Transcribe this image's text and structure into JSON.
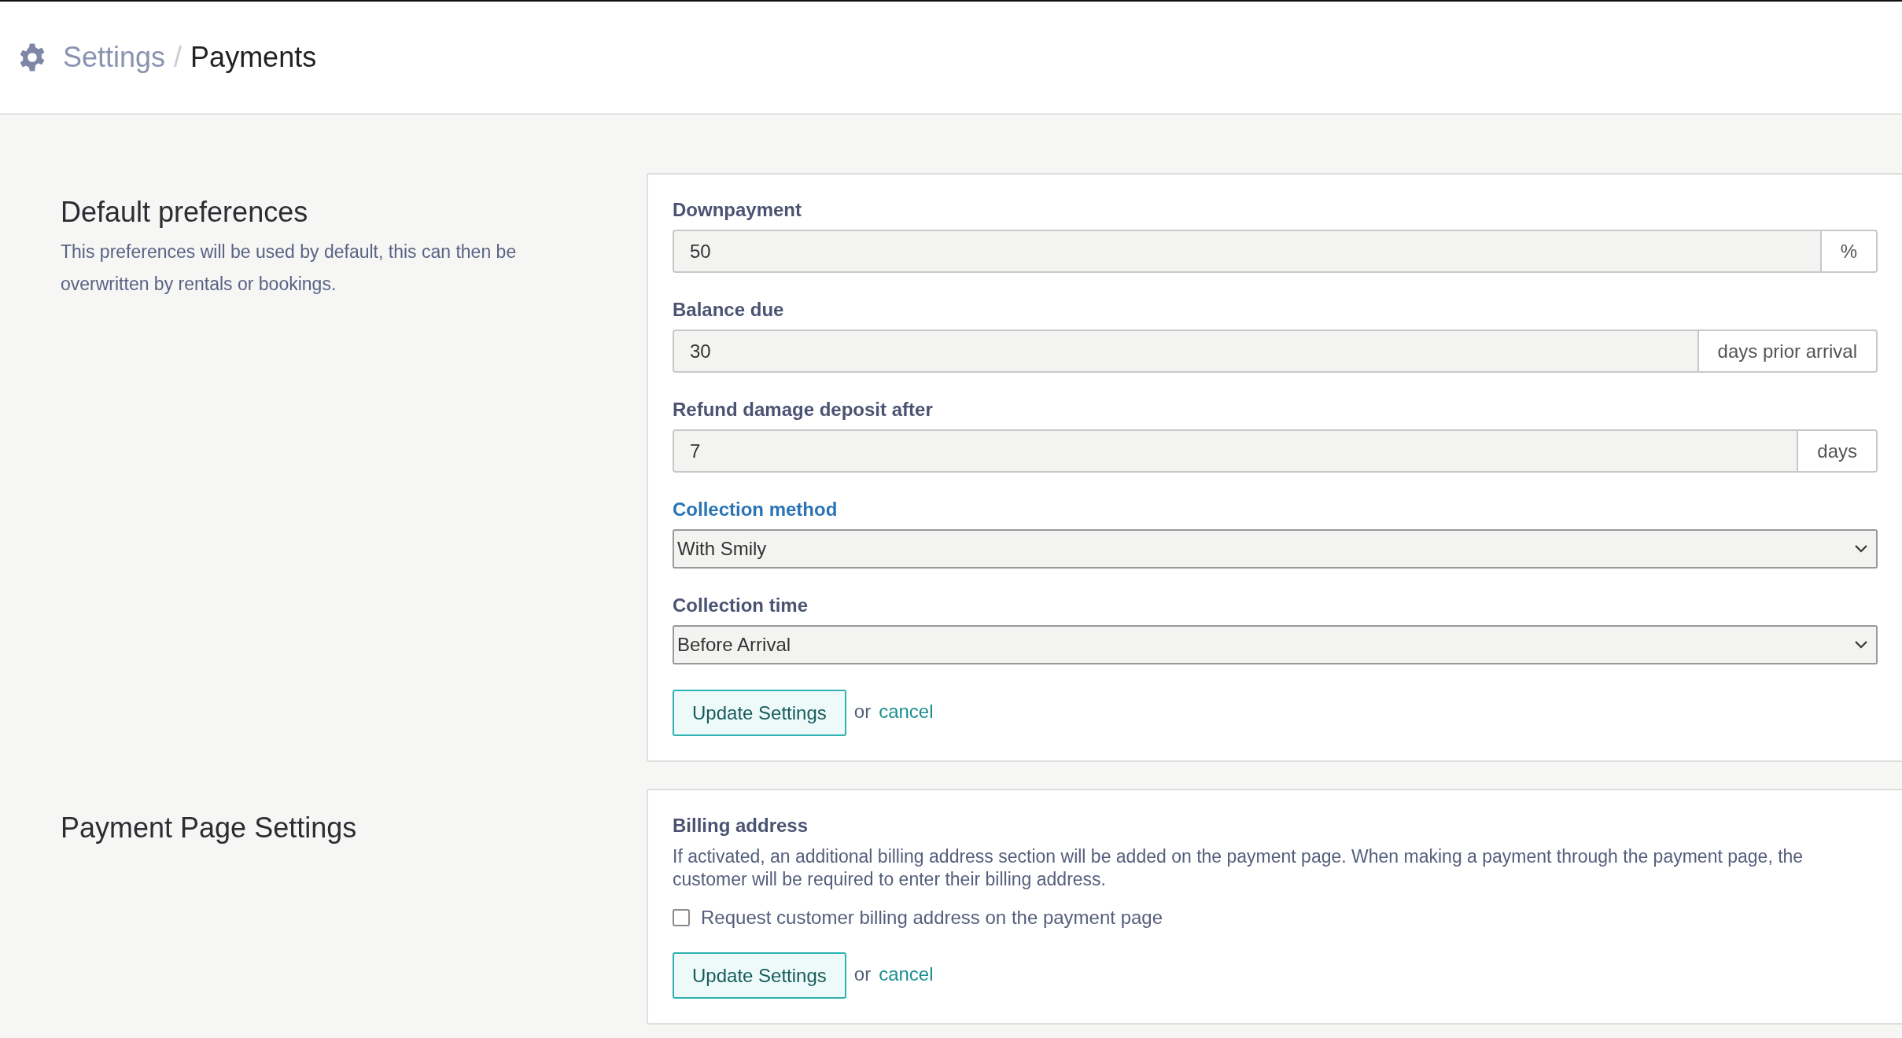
{
  "header": {
    "separator": "/",
    "breadcrumb": [
      {
        "label": "Settings",
        "current": false
      },
      {
        "label": "Payments",
        "current": true
      }
    ]
  },
  "sections": [
    {
      "title": "Default preferences",
      "description": "This preferences will be used by default, this can then be overwritten by rentals or bookings.",
      "fields": [
        {
          "kind": "addon",
          "label": "Downpayment",
          "value": "50",
          "addon": "%",
          "focused": false
        },
        {
          "kind": "addon",
          "label": "Balance due",
          "value": "30",
          "addon": "days prior arrival",
          "focused": false
        },
        {
          "kind": "addon",
          "label": "Refund damage deposit after",
          "value": "7",
          "addon": "days",
          "focused": false
        },
        {
          "kind": "select",
          "label": "Collection method",
          "value": "With Smily",
          "focused": true
        },
        {
          "kind": "select",
          "label": "Collection time",
          "value": "Before Arrival",
          "focused": false
        }
      ],
      "submit": "Update Settings",
      "or": "or",
      "cancel": "cancel"
    },
    {
      "title": "Payment Page Settings",
      "fields": [
        {
          "kind": "check",
          "label": "Billing address",
          "text": "If activated, an additional billing address section will be added on the payment page. When making a payment through the payment page, the customer will be required to enter their billing address.",
          "checkbox": {
            "label": "Request customer billing address on the payment page",
            "checked": false
          },
          "focused": false
        }
      ],
      "submit": "Update Settings",
      "or": "or",
      "cancel": "cancel"
    }
  ]
}
